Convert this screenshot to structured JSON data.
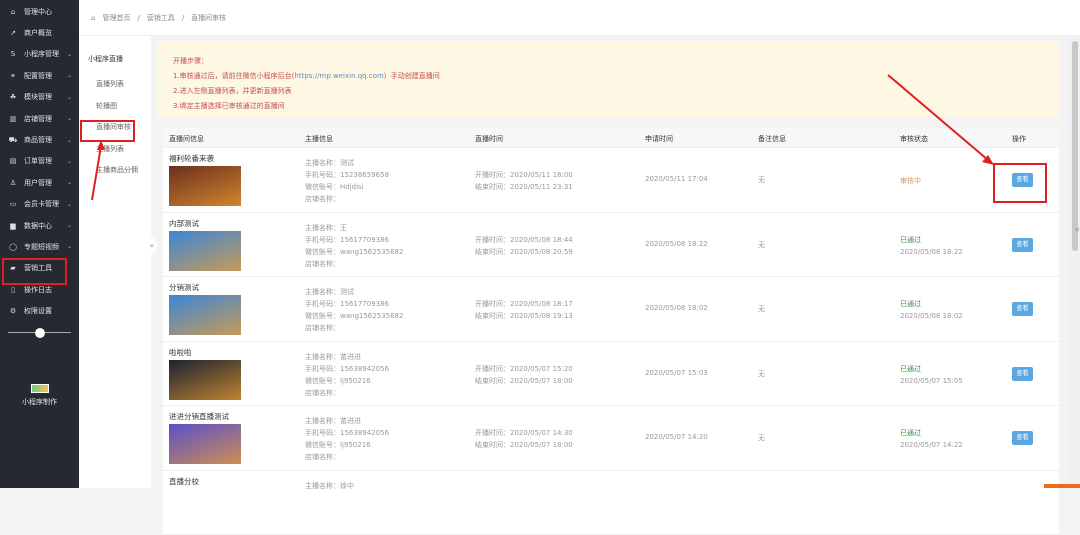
{
  "sidebar": {
    "items": [
      {
        "icon": "home-icon",
        "glyph": "⌂",
        "label": "管理中心",
        "chev": false
      },
      {
        "icon": "chart-line-icon",
        "glyph": "↗",
        "label": "商户概览",
        "chev": false
      },
      {
        "icon": "dollar-icon",
        "glyph": "S",
        "label": "小程序管理",
        "chev": true
      },
      {
        "icon": "share-icon",
        "glyph": "⚭",
        "label": "配置管理",
        "chev": true
      },
      {
        "icon": "modules-icon",
        "glyph": "☘",
        "label": "模块管理",
        "chev": true
      },
      {
        "icon": "store-icon",
        "glyph": "▥",
        "label": "店铺管理",
        "chev": true
      },
      {
        "icon": "cart-icon",
        "glyph": "⛟",
        "label": "商品管理",
        "chev": true
      },
      {
        "icon": "order-icon",
        "glyph": "▤",
        "label": "订单管理",
        "chev": true
      },
      {
        "icon": "user-icon",
        "glyph": "♙",
        "label": "用户管理",
        "chev": true
      },
      {
        "icon": "card-icon",
        "glyph": "▭",
        "label": "会员卡管理",
        "chev": true
      },
      {
        "icon": "bar-chart-icon",
        "glyph": "▆",
        "label": "数据中心",
        "chev": true
      },
      {
        "icon": "video-icon",
        "glyph": "◯",
        "label": "专题短视频",
        "chev": true
      },
      {
        "icon": "briefcase-icon",
        "glyph": "▰",
        "label": "营销工具",
        "chev": false
      },
      {
        "icon": "log-icon",
        "glyph": "▯",
        "label": "操作日志",
        "chev": false
      },
      {
        "icon": "gear-icon",
        "glyph": "⚙",
        "label": "权限设置",
        "chev": false
      }
    ],
    "brand": "小程序制作"
  },
  "breadcrumb": [
    "管理首页",
    "/",
    "营销工具",
    "/",
    "直播间审核"
  ],
  "subnav": {
    "title": "小程序直播",
    "items": [
      "直播列表",
      "轮播图",
      "直播间审核",
      "主播列表",
      "主播商品分佣"
    ]
  },
  "notice": {
    "title": "开播步骤：",
    "line1_pre": "1.审核通过后，请前往微信小程序后台(",
    "url": "https://mp.weixin.qq.com",
    "line1_post": "）手动创建直播间",
    "line2": "2.进入左侧直播列表，并更新直播列表",
    "line3": "3.绑定主播选择已审核通过的直播间"
  },
  "table": {
    "headers": [
      "直播间信息",
      "主播信息",
      "直播时间",
      "申请时间",
      "备注信息",
      "审核状态",
      "操作"
    ],
    "labels": {
      "anchor_name": "主播名称：",
      "phone": "手机号码：",
      "wechat": "微信账号：",
      "store": "店铺名称：",
      "start": "开播时间：",
      "end": "结束时间："
    },
    "rows": [
      {
        "title": "福利轮番来袭",
        "anchor": "测试",
        "phone": "15238659658",
        "wechat": "Hdjdisi",
        "start": "2020/05/11 18:00",
        "end": "2020/05/11 23:31",
        "applied": "2020/05/11 17:04",
        "remark": "无",
        "status": "审核中",
        "status_time": "",
        "status_type": "pending",
        "action": "查看",
        "thumb": "#6b2f1f"
      },
      {
        "title": "内部测试",
        "anchor": "王",
        "phone": "15617709386",
        "wechat": "wang1562535682",
        "start": "2020/05/08 18:44",
        "end": "2020/05/08 20:59",
        "applied": "2020/05/08 18:22",
        "remark": "无",
        "status": "已通过",
        "status_time": "2020/05/08 18:22",
        "status_type": "ok",
        "action": "查看",
        "thumb": "#3c86d8"
      },
      {
        "title": "分销测试",
        "anchor": "测试",
        "phone": "15617709386",
        "wechat": "wang1562535682",
        "start": "2020/05/08 18:17",
        "end": "2020/05/08 19:13",
        "applied": "2020/05/08 18:02",
        "remark": "无",
        "status": "已通过",
        "status_time": "2020/05/08 18:02",
        "status_type": "ok",
        "action": "查看",
        "thumb": "#3c86d8"
      },
      {
        "title": "啦啦啦",
        "anchor": "苗进进",
        "phone": "15638942056",
        "wechat": "lj950216",
        "start": "2020/05/07 15:20",
        "end": "2020/05/07 18:00",
        "applied": "2020/05/07 15:03",
        "remark": "无",
        "status": "已通过",
        "status_time": "2020/05/07 15:05",
        "status_type": "ok",
        "action": "查看",
        "thumb": "#1c2230"
      },
      {
        "title": "进进分销直播测试",
        "anchor": "苗进进",
        "phone": "15638942056",
        "wechat": "lj950216",
        "start": "2020/05/07 14:30",
        "end": "2020/05/07 18:00",
        "applied": "2020/05/07 14:20",
        "remark": "无",
        "status": "已通过",
        "status_time": "2020/05/07 14:22",
        "status_type": "ok",
        "action": "查看",
        "thumb": "#5a4fc8"
      },
      {
        "title": "直播分校",
        "anchor": "徐中",
        "phone": "",
        "wechat": "",
        "start": "",
        "end": "",
        "applied": "",
        "remark": "",
        "status": "",
        "status_time": "",
        "status_type": "ok",
        "action": "",
        "thumb": ""
      }
    ]
  }
}
